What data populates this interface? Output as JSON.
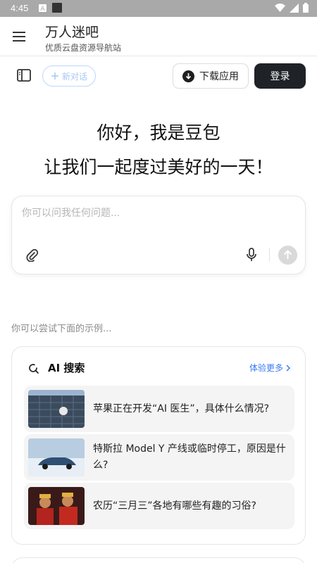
{
  "status_bar": {
    "time": "4:45"
  },
  "app_bar": {
    "title": "万人迷吧",
    "subtitle": "优质云盘资源导航站"
  },
  "toolbar": {
    "new_chat_label": "新对话",
    "download_label": "下载应用",
    "login_label": "登录"
  },
  "greeting": {
    "line1": "你好，我是豆包",
    "line2": "让我们一起度过美好的一天！"
  },
  "chat_input": {
    "placeholder": "你可以问我任何问题..."
  },
  "examples_hint": "你可以尝试下面的示例...",
  "suggestion_card": {
    "title": "AI 搜索",
    "more_label": "体验更多",
    "items": [
      {
        "text": "苹果正在开发“AI 医生”，具体什么情况?"
      },
      {
        "text": "特斯拉 Model Y 产线或临时停工，原因是什么?"
      },
      {
        "text": "农历“三月三”各地有哪些有趣的习俗?"
      }
    ]
  },
  "colors": {
    "accent": "#3a7bf2",
    "login_bg": "#1f2328",
    "status_bar": "#a9a9a9"
  },
  "icons": [
    "menu-icon",
    "sidebar-icon",
    "plus-icon",
    "download-icon",
    "attach-icon",
    "mic-icon",
    "send-icon",
    "search-refresh-icon",
    "chevron-right-icon"
  ]
}
